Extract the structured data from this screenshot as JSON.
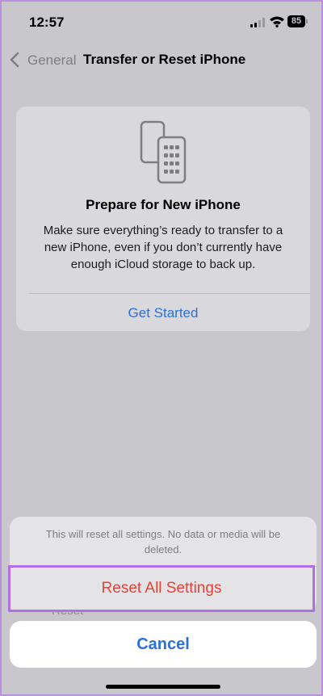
{
  "status_bar": {
    "time": "12:57",
    "battery": "85"
  },
  "nav": {
    "back_label": "General",
    "title": "Transfer or Reset iPhone"
  },
  "card": {
    "icon": "two-phones-icon",
    "title": "Prepare for New iPhone",
    "body": "Make sure everything’s ready to transfer to a new iPhone, even if you don’t currently have enough iCloud storage to back up.",
    "link": "Get Started"
  },
  "background_peek": "Reset",
  "action_sheet": {
    "message": "This will reset all settings. No data or media will be deleted.",
    "reset_label": "Reset All Settings",
    "cancel_label": "Cancel"
  },
  "colors": {
    "accent_blue": "#2d70d6",
    "destructive_red": "#e5423a",
    "highlight_purple": "#b26ee9"
  }
}
